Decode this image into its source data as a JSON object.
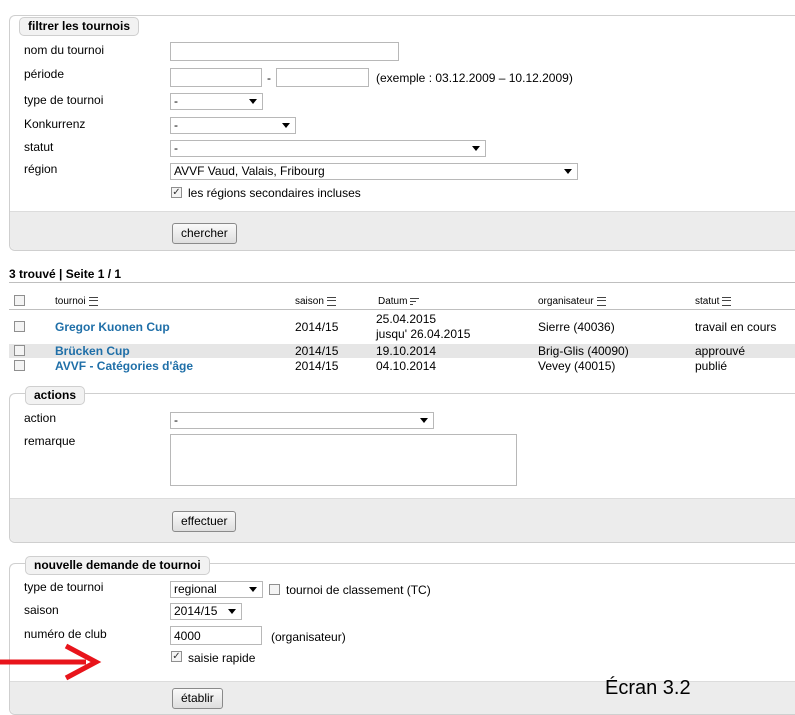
{
  "filter": {
    "legend": "filtrer les tournois",
    "name_label": "nom du tournoi",
    "name_value": "",
    "period_label": "période",
    "period_from": "",
    "period_sep": "-",
    "period_to": "",
    "period_example": "(exemple : 03.12.2009 – 10.12.2009)",
    "type_label": "type de tournoi",
    "type_value": "-",
    "konkurrenz_label": "Konkurrenz",
    "konkurrenz_value": "-",
    "status_label": "statut",
    "status_value": "-",
    "region_label": "région",
    "region_value": "AVVF Vaud, Valais, Fribourg",
    "secondary_regions_label": "les régions secondaires incluses",
    "secondary_regions_checked": true,
    "search_button": "chercher"
  },
  "results": {
    "summary": "3 trouvé | Seite 1 / 1",
    "headers": {
      "tournament": "tournoi",
      "season": "saison",
      "date": "Datum",
      "organizer": "organisateur",
      "status": "statut"
    },
    "rows": [
      {
        "name": "Gregor Kuonen Cup",
        "season": "2014/15",
        "date": "25.04.2015",
        "date2": "jusqu' 26.04.2015",
        "organizer": "Sierre (40036)",
        "status": "travail en cours"
      },
      {
        "name": "Brücken Cup",
        "season": "2014/15",
        "date": "19.10.2014",
        "date2": "",
        "organizer": "Brig-Glis (40090)",
        "status": "approuvé"
      },
      {
        "name": "AVVF - Catégories d'âge",
        "season": "2014/15",
        "date": "04.10.2014",
        "date2": "",
        "organizer": "Vevey (40015)",
        "status": "publié"
      }
    ]
  },
  "actions": {
    "legend": "actions",
    "action_label": "action",
    "action_value": "-",
    "remark_label": "remarque",
    "remark_value": "",
    "submit_button": "effectuer"
  },
  "new_request": {
    "legend": "nouvelle demande de tournoi",
    "type_label": "type de tournoi",
    "type_value": "regional",
    "ranking_label": "tournoi de classement (TC)",
    "ranking_checked": false,
    "season_label": "saison",
    "season_value": "2014/15",
    "club_label": "numéro de club",
    "club_value": "4000",
    "club_hint": "(organisateur)",
    "quick_entry_label": "saisie rapide",
    "quick_entry_checked": true,
    "create_button": "établir"
  },
  "caption": "Écran 3.2",
  "colors": {
    "link": "#1f6fa8",
    "arrow": "#e8141b",
    "footer_bg": "#ececec"
  }
}
